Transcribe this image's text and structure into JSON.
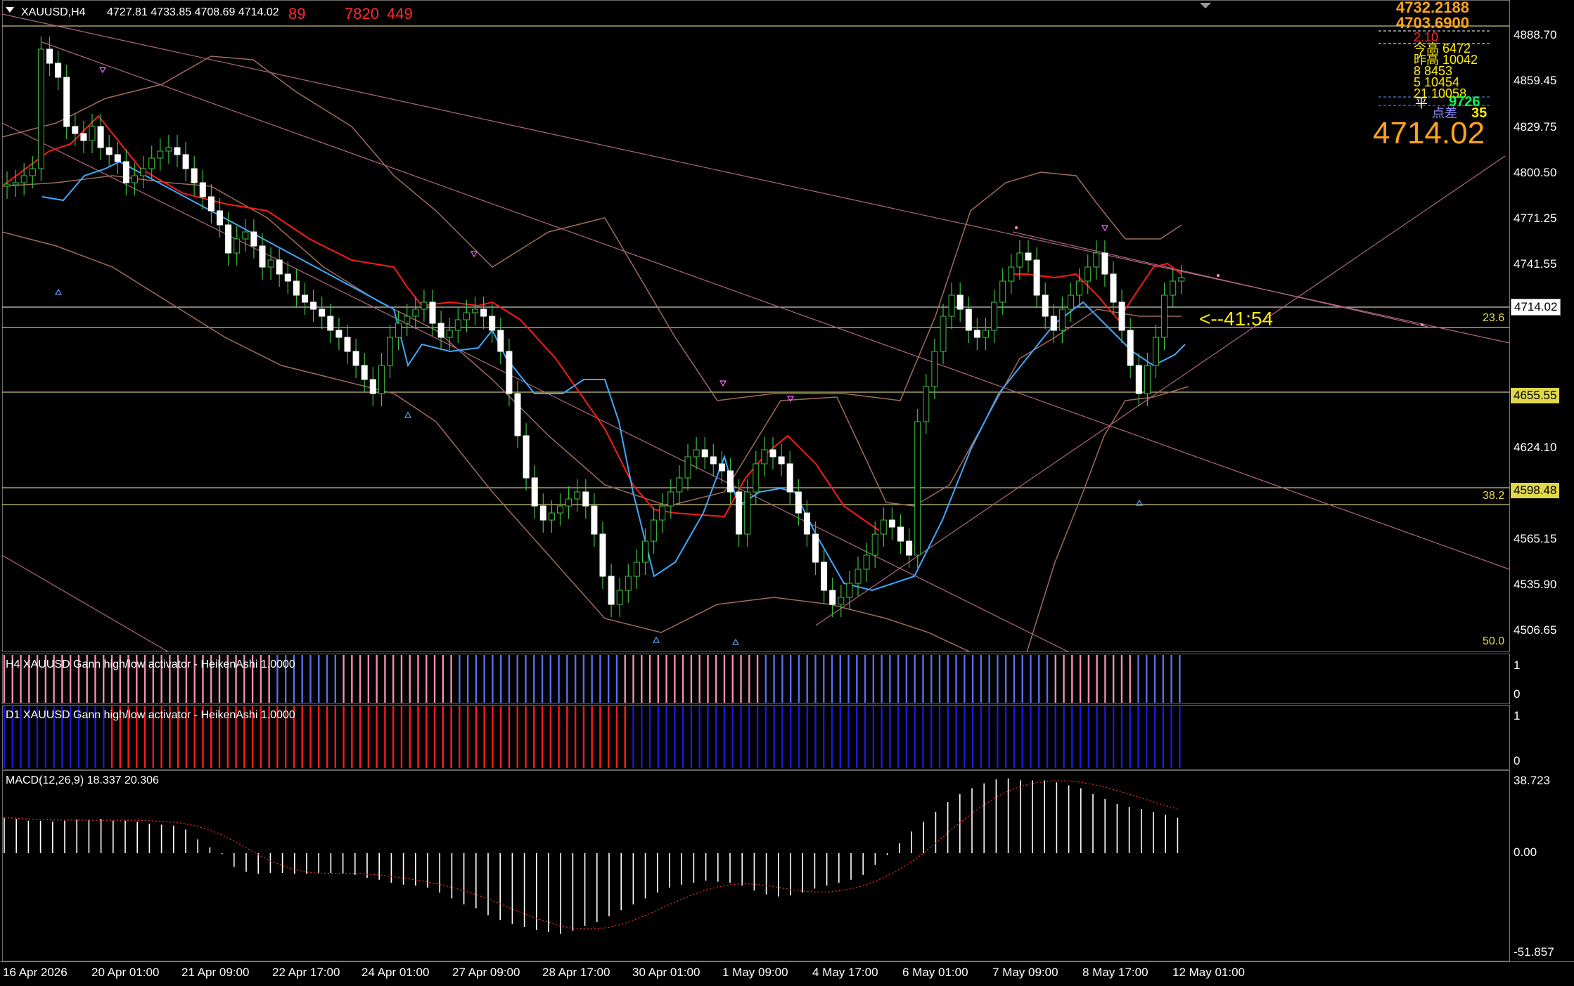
{
  "header": {
    "symbol_tf": "XAUUSD,H4",
    "ohlc": "4727.81 4733.85 4708.69 4714.02",
    "overlay_text_a": "89",
    "overlay_text_b": "7820",
    "overlay_text_c": "449"
  },
  "price_axis": {
    "ticks": [
      "4888.70",
      "4859.45",
      "4829.75",
      "4800.50",
      "4771.25",
      "4741.55",
      "4624.10",
      "4565.15",
      "4535.90",
      "4506.65"
    ],
    "current_price_tag": "4714.02",
    "yellow_tag_1": "4598.48",
    "yellow_tag_2": "4655.55"
  },
  "info_panel": {
    "big_price": "4714.02",
    "row_1": "4732.2188",
    "row_2": "4703.6900",
    "row_3": "2.10",
    "row_4": "今高 6472",
    "row_5": "昨高 10042",
    "row_6": "8    8453",
    "row_7": "5    10454",
    "row_8": "21   10058",
    "row_9_label": "平",
    "row_9_value": "9726",
    "row_10_label": "点差",
    "row_10_value": "35"
  },
  "annotations": {
    "countdown": "<--41:54",
    "fib_23": "23.6",
    "fib_38": "38.2",
    "fib_50": "50.0"
  },
  "indicators": {
    "gann_h4_title": "H4 XAUUSD Gann high/low activator - HeikenAshi 1.0000",
    "gann_d1_title": "D1 XAUUSD Gann high/low activator - HeikenAshi 1.0000",
    "gann_scale_top": "1",
    "gann_scale_bottom": "0",
    "macd_title": "MACD(12,26,9) 18.337 20.306",
    "macd_top": "38.723",
    "macd_zero": "0.00",
    "macd_bottom": "-51.857"
  },
  "time_axis": {
    "labels": [
      "16 Apr 2026",
      "20 Apr 01:00",
      "21 Apr 09:00",
      "22 Apr 17:00",
      "24 Apr 01:00",
      "27 Apr 09:00",
      "28 Apr 17:00",
      "30 Apr 01:00",
      "1 May 09:00",
      "4 May 17:00",
      "6 May 01:00",
      "7 May 09:00",
      "8 May 17:00",
      "12 May 01:00"
    ]
  },
  "colors": {
    "background": "#000000",
    "bull_candle": "#ffffff",
    "wick": "#3fbf3f",
    "red_line": "#ff1a1a",
    "blue_line": "#3fa8ff",
    "band": "#a06b5c",
    "trend": "#b06680",
    "fib": "#b9b25c",
    "gann_pink": "#f08fb4",
    "gann_blue": "#5b6ee8",
    "gann_red": "#ff1a1a",
    "gann_navy": "#1a1ad8",
    "orange": "#ffa31a",
    "yellow": "#ffee00",
    "green_text": "#00ff55"
  },
  "avatar": {
    "icon": "avatar-icon"
  }
}
